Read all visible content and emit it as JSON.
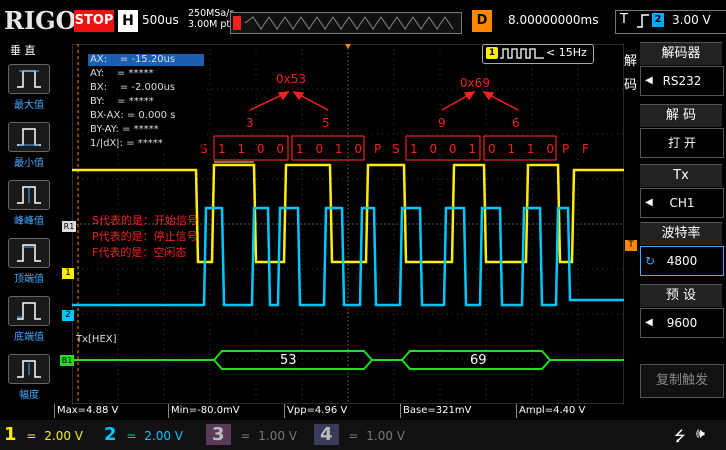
{
  "top": {
    "brand": "RIGOL",
    "run_status": "STOP",
    "h_tag": "H",
    "timebase": "500us",
    "sample_rate_1": "250MSa/s",
    "sample_rate_2": "3.00M pts",
    "d_tag": "D",
    "delay": "8.00000000ms",
    "trig_t": "T",
    "trig_source": "2",
    "trig_level": "3.00 V"
  },
  "left": {
    "title": "垂 直",
    "items": [
      {
        "label": "最大值"
      },
      {
        "label": "最小值"
      },
      {
        "label": "峰峰值"
      },
      {
        "label": "顶端值"
      },
      {
        "label": "底端值"
      },
      {
        "label": "幅度"
      }
    ]
  },
  "cursor": {
    "rows": [
      "AX:    = -15.20us",
      "AY:    = *****",
      "BX:    = -2.000us",
      "BY:    = *****",
      "BX-AX: = 0.000 s",
      "BY-AY: = *****",
      "1/|dX|: = *****"
    ]
  },
  "freq": {
    "badge": "1",
    "text": "< 15Hz"
  },
  "annotations": {
    "hex1": "0x53",
    "hex2": "0x69",
    "d3": "3",
    "d5": "5",
    "d9": "9",
    "d6": "6",
    "bits1_S": "S",
    "bits1_n1": "1 1 0 0",
    "bits1_n2": "1 0 1 0",
    "bits1_P": "P",
    "bits2_S": "S",
    "bits2_n1": "1 0 0 1",
    "bits2_n2": "0 1 1 0",
    "bits2_P": "P",
    "bits2_F": "F",
    "note1": "S代表的是：开始信号",
    "note2": "P代表的是：停止信号",
    "note3": "F代表的是：空闲态"
  },
  "markers": {
    "r1": "R1",
    "ch1": "1",
    "ch2": "2",
    "b1": "B1",
    "tx_label": "Tx[HEX]",
    "t_marker": "T"
  },
  "decode": {
    "byte1": "53",
    "byte2": "69"
  },
  "right": {
    "side_label": "解码",
    "decoder_title": "解码器",
    "decoder_value": "RS232",
    "decode_title": "解 码",
    "decode_value": "打 开",
    "tx_title": "Tx",
    "tx_value": "CH1",
    "baud_title": "波特率",
    "baud_value": "4800",
    "preset_title": "预 设",
    "preset_value": "9600",
    "copy_trigger": "复制触发"
  },
  "status": {
    "max": "Max=4.88 V",
    "min": "Min=-80.0mV",
    "vpp": "Vpp=4.96 V",
    "base": "Base=321mV",
    "ampl": "Ampl=4.40 V"
  },
  "channels": [
    {
      "num": "1",
      "scale": "2.00 V",
      "color": "#ffee00"
    },
    {
      "num": "2",
      "scale": "2.00 V",
      "color": "#00c8ff"
    },
    {
      "num": "3",
      "scale": "1.00 V",
      "color": "#d060d0"
    },
    {
      "num": "4",
      "scale": "1.00 V",
      "color": "#3060ff"
    }
  ]
}
